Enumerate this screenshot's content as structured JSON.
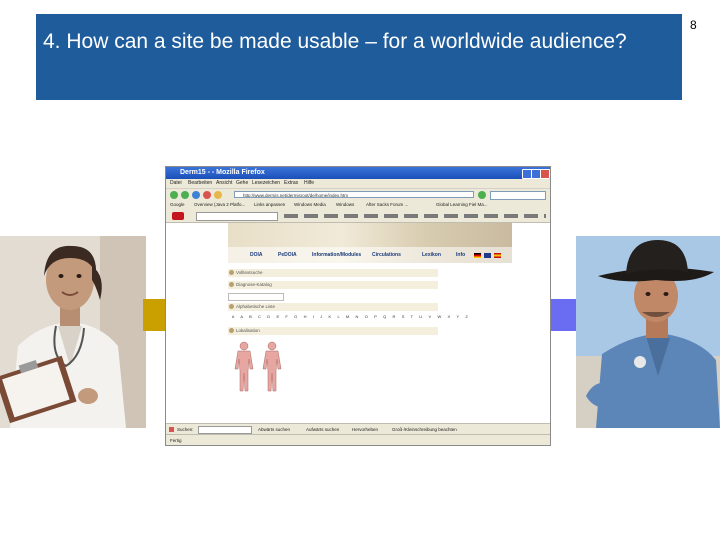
{
  "slide": {
    "title": "4. How can a site be made usable – for a worldwide audience?",
    "number": "8"
  },
  "colors": {
    "title_bg": "#1f5c9c",
    "arrow_left": "#c9a000",
    "arrow_right": "#6a6cf2"
  },
  "browser": {
    "window_title": "Derm15 - - Mozilla Firefox",
    "menu": [
      "Datei",
      "Bearbeiten",
      "Ansicht",
      "Gehe",
      "Lesezeichen",
      "Extras",
      "Hilfe"
    ],
    "address": "http://www.dermis.net/dermisroot/de/home/index.htm",
    "bookmarks": [
      "Google",
      "Overview (Java 2 Platfo...",
      "Links anpassen",
      "Windows Media",
      "Windows",
      "After Sacks Forum ...",
      "Global Learning Fiel Ma..."
    ],
    "site_nav": [
      "DOIA",
      "PeDOIA",
      "Information/Modules",
      "Circulations",
      "Lexikon",
      "Info"
    ],
    "rows": {
      "search": "Volltextsuche",
      "diagnosis": "Diagnose-Katalog",
      "alphabet": "Alphabetische Liste",
      "localization": "Lokalisation"
    },
    "alphabet_letters": "# A B C D E F G H I J K L M N O P Q R S T U V W X Y Z",
    "findbar": {
      "label": "Suchen:",
      "next": "Abwärts suchen",
      "prev": "Aufwärts suchen",
      "highlight": "Hervorheben",
      "case": "Groß-/Kleinschreibung beachten"
    },
    "status": "Fertig"
  }
}
